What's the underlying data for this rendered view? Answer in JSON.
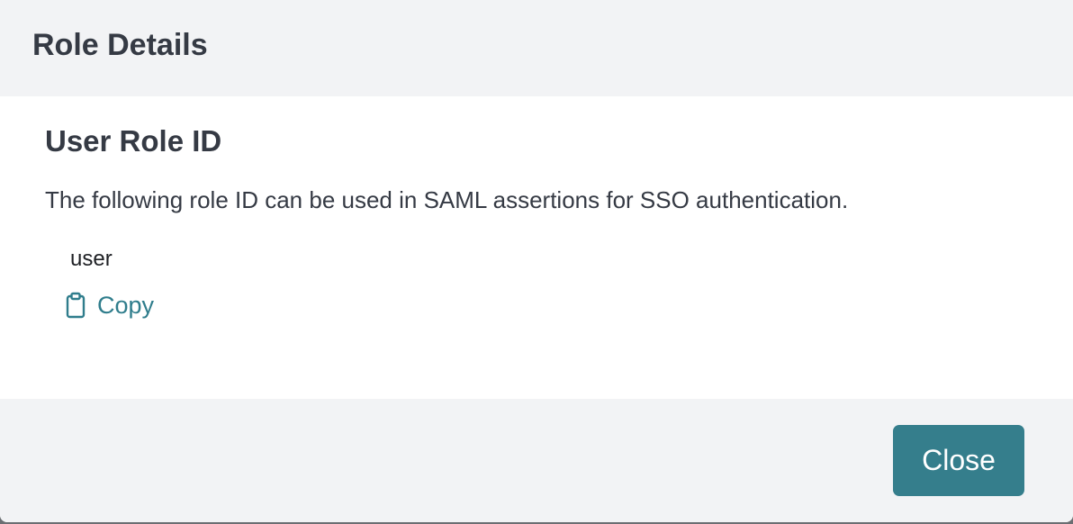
{
  "dialog": {
    "title": "Role Details"
  },
  "body": {
    "section_title": "User Role ID",
    "description": "The following role ID can be used in SAML assertions for SSO authentication.",
    "role_id": "user",
    "copy_label": "Copy",
    "copy_icon": "clipboard-icon"
  },
  "footer": {
    "close_label": "Close"
  },
  "colors": {
    "accent": "#357e8c",
    "link": "#2f7d8c",
    "header_bg": "#f2f3f5",
    "body_bg": "#ffffff",
    "text": "#353a44"
  }
}
